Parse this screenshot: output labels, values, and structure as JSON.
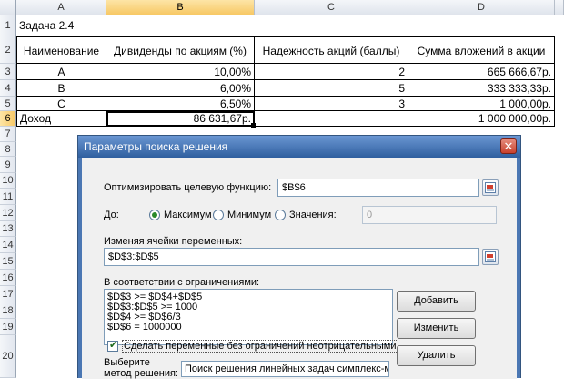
{
  "spreadsheet": {
    "columns": [
      "A",
      "B",
      "C",
      "D"
    ],
    "rows": [
      "1",
      "2",
      "3",
      "4",
      "5",
      "6",
      "7",
      "8",
      "9",
      "10",
      "11",
      "12",
      "13",
      "14",
      "15",
      "16",
      "17",
      "18",
      "19",
      "20"
    ],
    "title": "Задача 2.4",
    "headers": [
      "Наименование",
      "Дивиденды по акциям (%)",
      "Надежность акций (баллы)",
      "Сумма вложений в акции"
    ],
    "data_rows": [
      [
        "А",
        "10,00%",
        "2",
        "665 666,67р."
      ],
      [
        "В",
        "6,00%",
        "5",
        "333 333,33р."
      ],
      [
        "С",
        "6,50%",
        "3",
        "1 000,00р."
      ]
    ],
    "total_label": "Доход",
    "total_b": "86 631,67р.",
    "total_d": "1 000 000,00р."
  },
  "dialog": {
    "title": "Параметры поиска решения",
    "close_glyph": "✕",
    "objective_label": "Оптимизировать целевую функцию:",
    "objective_value": "$B$6",
    "to_label": "До:",
    "radio_max": "Максимум",
    "radio_min": "Минимум",
    "radio_value": "Значения:",
    "value_field": "0",
    "variables_label": "Изменяя ячейки переменных:",
    "variables_value": "$D$3:$D$5",
    "constraints_label": "В соответствии с ограничениями:",
    "constraints": [
      "$D$3 >= $D$4+$D$5",
      "$D$3:$D$5 >= 1000",
      "$D$4 >= $D$6/3",
      "$D$6 = 1000000"
    ],
    "btn_add": "Добавить",
    "btn_change": "Изменить",
    "btn_delete": "Удалить",
    "nonneg_label": "Сделать переменные без ограничений неотрицательными",
    "method_label_1": "Выберите",
    "method_label_2": "метод решения:",
    "method_value": "Поиск решения линейных задач симплекс-методом"
  },
  "colors": {
    "selected_header": "#f7c865",
    "title_bar": "#2f5f9f"
  }
}
